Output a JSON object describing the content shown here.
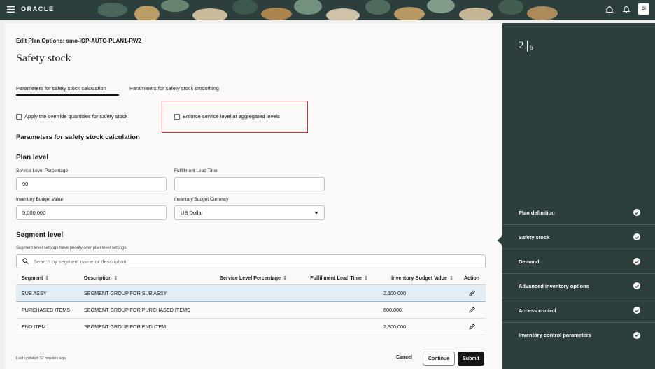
{
  "header": {
    "brand": "ORACLE",
    "avatar_initials": "SI",
    "menu_icon": "hamburger-icon",
    "home_icon": "home-icon",
    "notifications_icon": "bell-icon"
  },
  "page": {
    "edit_title": "Edit Plan Options: smo-IOP-AUTO-PLAN1-RW2",
    "title": "Safety stock"
  },
  "tabs": [
    {
      "label": "Parameters for safety stock calculation",
      "selected": true
    },
    {
      "label": "Parameters for safety stock smoothing",
      "selected": false
    }
  ],
  "checkboxes": {
    "override": "Apply the override quantities for safety stock",
    "enforce": "Enforce service level at aggregated levels"
  },
  "section_title": "Parameters for safety stock calculation",
  "plan_level": {
    "title": "Plan level",
    "service_level_label": "Service Level Percentage",
    "service_level_value": "90",
    "fulfillment_lead_time_label": "Fulfillment Lead Time",
    "fulfillment_lead_time_value": "",
    "budget_value_label": "Inventory Budget Value",
    "budget_value": "5,000,000",
    "budget_currency_label": "Inventory Budget Currency",
    "budget_currency": "US Dollar"
  },
  "segment_level": {
    "title": "Segment level",
    "note": "Segment level settings have priority over plan level settings.",
    "search_placeholder": "Search by segment name or description",
    "columns": [
      "Segment",
      "Description",
      "Service Level Percentage",
      "Fulfillment Lead Time",
      "Inventory Budget Value",
      "Action"
    ],
    "rows": [
      {
        "segment": "SUB ASSY",
        "description": "SEGMENT GROUP FOR SUB ASSY",
        "service_level": "",
        "lead_time": "",
        "budget": "2,100,000"
      },
      {
        "segment": "PURCHASED ITEMS",
        "description": "SEGMENT GROUP FOR PURCHASED ITEMS",
        "service_level": "",
        "lead_time": "",
        "budget": "600,000"
      },
      {
        "segment": "END ITEM",
        "description": "SEGMENT GROUP FOR END ITEM",
        "service_level": "",
        "lead_time": "",
        "budget": "2,300,000"
      }
    ]
  },
  "footer": {
    "last_updated": "Last updated 32 minutes ago",
    "cancel": "Cancel",
    "continue": "Continue",
    "submit": "Submit"
  },
  "train": {
    "current_step": "2",
    "total_steps": "6",
    "stops": [
      "Plan definition",
      "Safety stock",
      "Demand",
      "Advanced inventory options",
      "Access control",
      "Inventory control parameters"
    ]
  },
  "colors": {
    "header_bg": "#2d3f3d",
    "highlight": "#d2272a",
    "selected_row": "#e2eef6"
  }
}
